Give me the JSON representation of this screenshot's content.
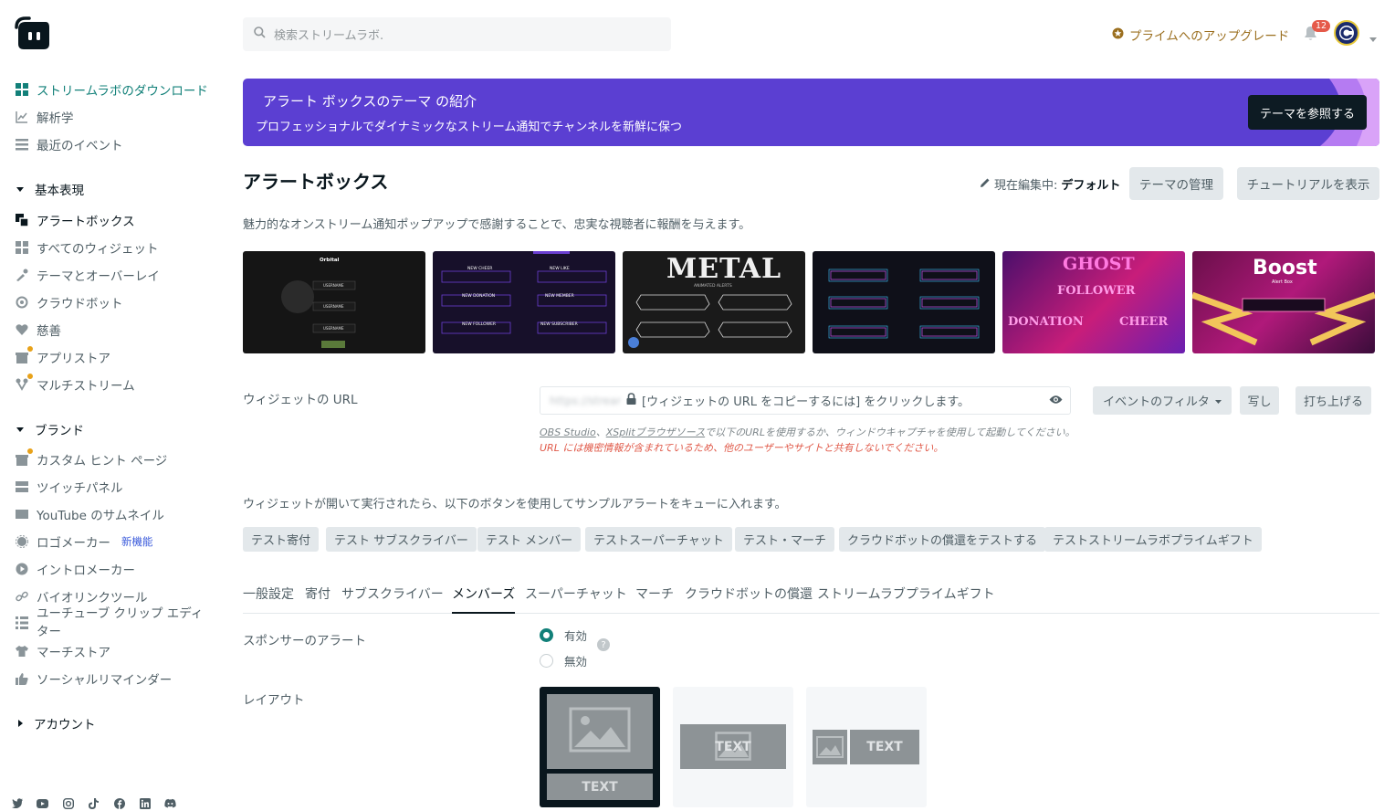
{
  "sidebar": {
    "items_top": [
      {
        "label": "ストリームラボのダウンロード",
        "icon": "windows-icon"
      },
      {
        "label": "解析学",
        "icon": "chart-icon"
      },
      {
        "label": "最近のイベント",
        "icon": "list-icon"
      }
    ],
    "section_basic": "基本表現",
    "items_basic": [
      {
        "label": "アラートボックス",
        "icon": "alert-box-icon"
      },
      {
        "label": "すべてのウィジェット",
        "icon": "widgets-icon"
      },
      {
        "label": "テーマとオーバーレイ",
        "icon": "paint-icon"
      },
      {
        "label": "クラウドボット",
        "icon": "cloudbot-icon"
      },
      {
        "label": "慈善",
        "icon": "heart-icon"
      },
      {
        "label": "アプリストア",
        "icon": "store-icon"
      },
      {
        "label": "マルチストリーム",
        "icon": "multistream-icon"
      }
    ],
    "section_brand": "ブランド",
    "items_brand": [
      {
        "label": "カスタム ヒント ページ",
        "icon": "tip-page-icon"
      },
      {
        "label": "ツイッチパネル",
        "icon": "panel-icon"
      },
      {
        "label": "YouTube のサムネイル",
        "icon": "thumbnail-icon"
      },
      {
        "label": "ロゴメーカー",
        "icon": "logo-maker-icon",
        "tag": "新機能"
      },
      {
        "label": "イントロメーカー",
        "icon": "intro-icon"
      },
      {
        "label": "バイオリンクツール",
        "icon": "link-icon"
      },
      {
        "label": "ユーチューブ クリップ エディ",
        "label2": "ター",
        "icon": "clip-editor-icon"
      },
      {
        "label": "マーチストア",
        "icon": "shirt-icon"
      },
      {
        "label": "ソーシャルリマインダー",
        "icon": "thumbs-up-icon"
      }
    ],
    "section_account": "アカウント"
  },
  "topbar": {
    "search_placeholder": "検索ストリームラボ.",
    "upgrade": "プライムへのアップグレード",
    "notifications": "12"
  },
  "banner": {
    "title": "アラート ボックスのテーマ の紹介",
    "subtitle": "プロフェッショナルでダイナミックなストリーム通知でチャンネルを新鮮に保つ",
    "button": "テーマを参照する"
  },
  "header": {
    "title": "アラートボックス",
    "editing_label": "現在編集中:",
    "editing_value": "デフォルト",
    "manage_themes": "テーマの管理",
    "tutorial": "チュートリアルを表示",
    "description": "魅力的なオンストリーム通知ポップアップで感謝することで、忠実な視聴者に報酬を与えます。"
  },
  "themes": {
    "metal_title": "METAL",
    "metal_sub": "ANIMATED ALERTS",
    "ghost_title": "GHOST",
    "ghost_follower": "FOLLOWER",
    "ghost_donation": "DONATION",
    "ghost_cheer": "CHEER",
    "boost_title": "Boost",
    "boost_sub": "Alert Box",
    "orbital_title": "Orbital",
    "username": "USERNAME",
    "cheer_labels": [
      "NEW CHEER",
      "NEW LIKE",
      "NEW DONATION",
      "NEW MEMBER",
      "NEW FOLLOWER",
      "NEW SUBSCRIBER"
    ]
  },
  "widget_url": {
    "label": "ウィジェットの URL",
    "masked_url": "https://streamlabs.com/alert-box/v3/",
    "click_text": "[ウィジェットの URL をコピーするには] をクリックします。",
    "filter": "イベントのフィルタ",
    "copy": "写し",
    "launch": "打ち上げる",
    "hint_obs": "OBS Studio",
    "hint_sep": "、",
    "hint_xsplit": "XSplitブラウザソース",
    "hint_rest": "で以下のURLを使用するか、ウィンドウキャプチャを使用して起動してください。",
    "warning": "URL には機密情報が含まれているため、他のユーザーやサイトと共有しないでください。"
  },
  "test_section": {
    "description": "ウィジェットが開いて実行されたら、以下のボタンを使用してサンプルアラートをキューに入れます。",
    "buttons": [
      "テスト寄付",
      "テスト サブスクライバー",
      "テスト メンバー",
      "テストスーパーチャット",
      "テスト・マーチ",
      "クラウドボットの償還をテストする",
      "テストストリームラボプライムギフト"
    ]
  },
  "tabs": [
    "一般設定",
    "寄付",
    "サブスクライバー",
    "メンバーズ",
    "スーパーチャット",
    "マーチ",
    "クラウドボットの償還",
    "ストリームラブプライムギフト"
  ],
  "sponsor": {
    "label": "スポンサーのアラート",
    "enabled": "有効",
    "disabled": "無効"
  },
  "layout": {
    "label": "レイアウト",
    "text": "TEXT"
  },
  "colors": {
    "accent": "#128079",
    "banner": "#5b3fd2",
    "warning": "#e05a4a",
    "upgrade": "#9b6f1f"
  }
}
